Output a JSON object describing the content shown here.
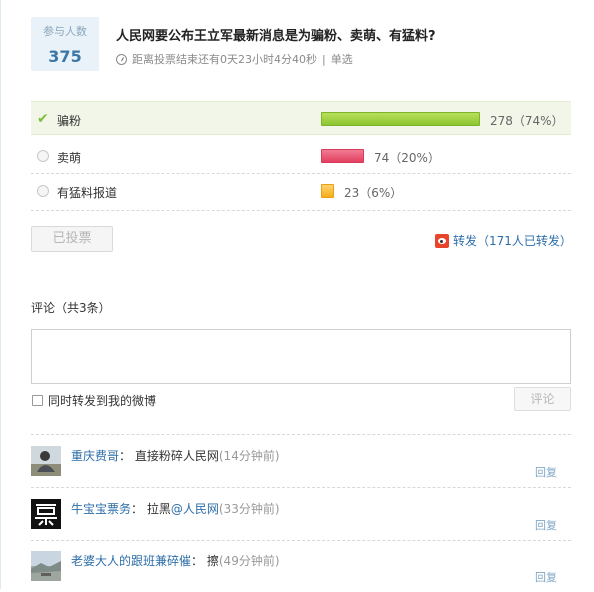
{
  "poll": {
    "participants_label": "参与人数",
    "participants_count": "375",
    "title": "人民网要公布王立军最新消息是为骗粉、卖萌、有猛料?",
    "countdown": "距离投票结束还有0天23小时4分40秒",
    "separator": "|",
    "mode": "单选"
  },
  "options": [
    {
      "label": "骗粉",
      "stat": "278（74%）",
      "votes": 278,
      "percent": 74,
      "selected": true,
      "color": "#8cc430"
    },
    {
      "label": "卖萌",
      "stat": "74（20%）",
      "votes": 74,
      "percent": 20,
      "selected": false,
      "color": "#e2405f"
    },
    {
      "label": "有猛料报道",
      "stat": "23（6%）",
      "votes": 23,
      "percent": 6,
      "selected": false,
      "color": "#f6ad1e"
    }
  ],
  "actions": {
    "voted_label": "已投票",
    "forward_label": "转发（171人已转发）"
  },
  "comments": {
    "heading": "评论（共3条）",
    "input_value": "",
    "also_forward_label": "同时转发到我的微博",
    "submit_label": "评论",
    "items": [
      {
        "user": "重庆费哥",
        "sep": "：",
        "text": "直接粉碎人民网",
        "at": "",
        "time": "(14分钟前)",
        "reply": "回复"
      },
      {
        "user": "牛宝宝票务",
        "sep": "：",
        "text": "拉黑",
        "at": "@人民网",
        "time": "(33分钟前)",
        "reply": "回复"
      },
      {
        "user": "老婆大人的跟班兼碎催",
        "sep": "：",
        "text": "擦",
        "at": "",
        "time": "(49分钟前)",
        "reply": "回复"
      }
    ]
  }
}
